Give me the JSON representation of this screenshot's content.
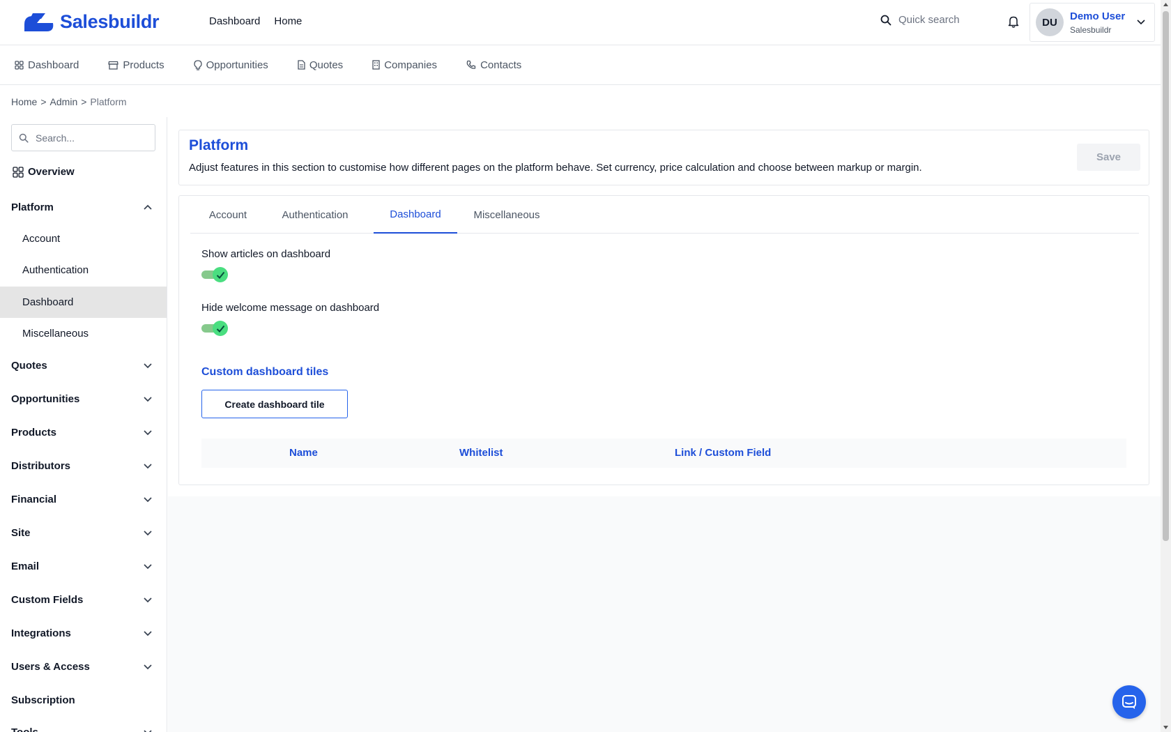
{
  "header": {
    "brand": "Salesbuildr",
    "links": [
      "Dashboard",
      "Home"
    ],
    "quick_search_placeholder": "Quick search",
    "user": {
      "initials": "DU",
      "name": "Demo User",
      "org": "Salesbuildr"
    }
  },
  "nav": {
    "items": [
      {
        "label": "Dashboard",
        "icon": "grid-icon"
      },
      {
        "label": "Products",
        "icon": "store-icon"
      },
      {
        "label": "Opportunities",
        "icon": "lightbulb-icon"
      },
      {
        "label": "Quotes",
        "icon": "document-icon"
      },
      {
        "label": "Companies",
        "icon": "building-icon"
      },
      {
        "label": "Contacts",
        "icon": "phone-icon"
      }
    ]
  },
  "breadcrumb": {
    "home": "Home",
    "admin": "Admin",
    "current": "Platform",
    "separator": ">"
  },
  "sidebar": {
    "search_placeholder": "Search...",
    "overview": "Overview",
    "platform": {
      "label": "Platform",
      "items": [
        "Account",
        "Authentication",
        "Dashboard",
        "Miscellaneous"
      ],
      "active": "Dashboard"
    },
    "sections": [
      "Quotes",
      "Opportunities",
      "Products",
      "Distributors",
      "Financial",
      "Site",
      "Email",
      "Custom Fields",
      "Integrations",
      "Users & Access",
      "Subscription",
      "Tools"
    ]
  },
  "page": {
    "title": "Platform",
    "description": "Adjust features in this section to customise how different pages on the platform behave. Set currency, price calculation and choose between markup or margin.",
    "save_label": "Save",
    "tabs": [
      "Account",
      "Authentication",
      "Dashboard",
      "Miscellaneous"
    ],
    "active_tab": "Dashboard",
    "settings": [
      {
        "label": "Show articles on dashboard",
        "enabled": true
      },
      {
        "label": "Hide welcome message on dashboard",
        "enabled": true
      }
    ],
    "tiles": {
      "title": "Custom dashboard tiles",
      "create_label": "Create dashboard tile",
      "columns": [
        "Name",
        "Whitelist",
        "Link / Custom Field"
      ]
    }
  },
  "colors": {
    "brand": "#1d4ed8",
    "toggle_on": "#4ade80",
    "active_sidebar": "#e5e5e5"
  }
}
